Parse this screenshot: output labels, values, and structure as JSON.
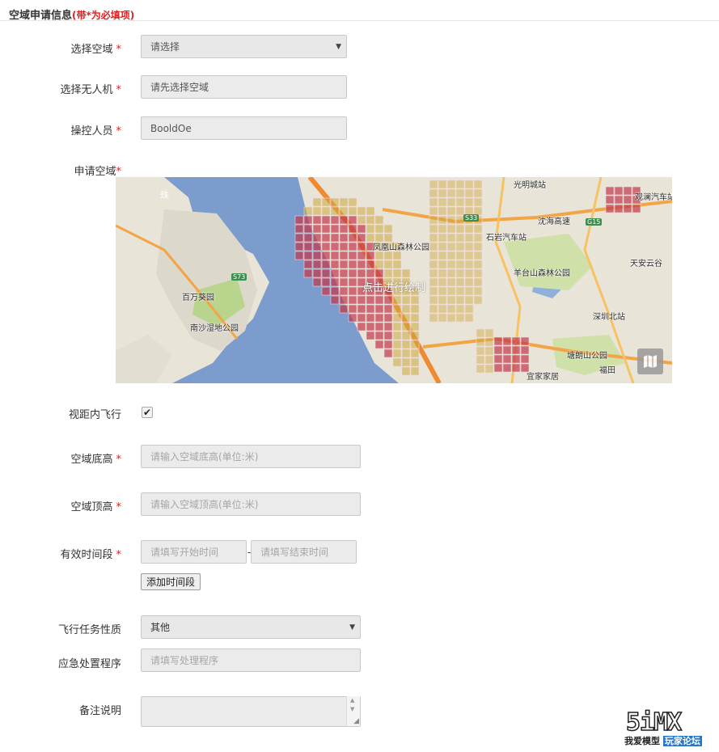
{
  "section": {
    "title": "空域申请信息",
    "required_note": "(带*为必填项)"
  },
  "required_mark": "*",
  "fields": {
    "airspace_select": {
      "label": "选择空域",
      "value": "请选择"
    },
    "drone_select": {
      "label": "选择无人机",
      "placeholder": "请先选择空域"
    },
    "operator": {
      "label": "操控人员",
      "value": "BooldOe"
    },
    "apply_area": {
      "label": "申请空域"
    },
    "vlos": {
      "label": "视距内飞行",
      "checked": true
    },
    "altitude_min": {
      "label": "空域底高",
      "placeholder": "请输入空域底高(单位:米)"
    },
    "altitude_max": {
      "label": "空域顶高",
      "placeholder": "请输入空域顶高(单位:米)"
    },
    "time_period": {
      "label": "有效时间段",
      "start_placeholder": "请填写开始时间",
      "separator": "-",
      "end_placeholder": "请填写结束时间",
      "add_button": "添加时间段"
    },
    "mission_type": {
      "label": "飞行任务性质",
      "value": "其他"
    },
    "emergency": {
      "label": "应急处置程序",
      "placeholder": "请填写处理程序"
    },
    "remarks": {
      "label": "备注说明"
    }
  },
  "map": {
    "prompt": "点击进行绘制",
    "labels": {
      "guangming": "光明城站",
      "fenghuang": "凤凰山森林公园",
      "shiyan": "石岩汽车站",
      "yangtai": "羊台山森林公园",
      "baiwan": "百万葵园",
      "nansha": "南沙湿地公园",
      "shenzhenbei": "深圳北站",
      "tanglang": "塘朗山公园",
      "ikea": "宜家家居",
      "tianan": "天安云谷",
      "guanlan": "观澜汽车站",
      "zhu": "珠",
      "s73": "S73",
      "s33": "S33",
      "g15": "G15",
      "expressway": "沈海高速",
      "futian": "福田"
    }
  },
  "watermark": {
    "logo": "5iMX",
    "sub1": "我爱模型",
    "sub2": "玩家论坛"
  },
  "icons": {
    "map_type": "map-icon",
    "select_arrow": "caret-down-icon",
    "checkbox": "checkmark-icon"
  },
  "colors": {
    "required": "#e02020",
    "grid_red": "#c0374a",
    "grid_yellow": "#c9a83c",
    "water": "#7b9ccc",
    "land": "#e9e4d8"
  }
}
